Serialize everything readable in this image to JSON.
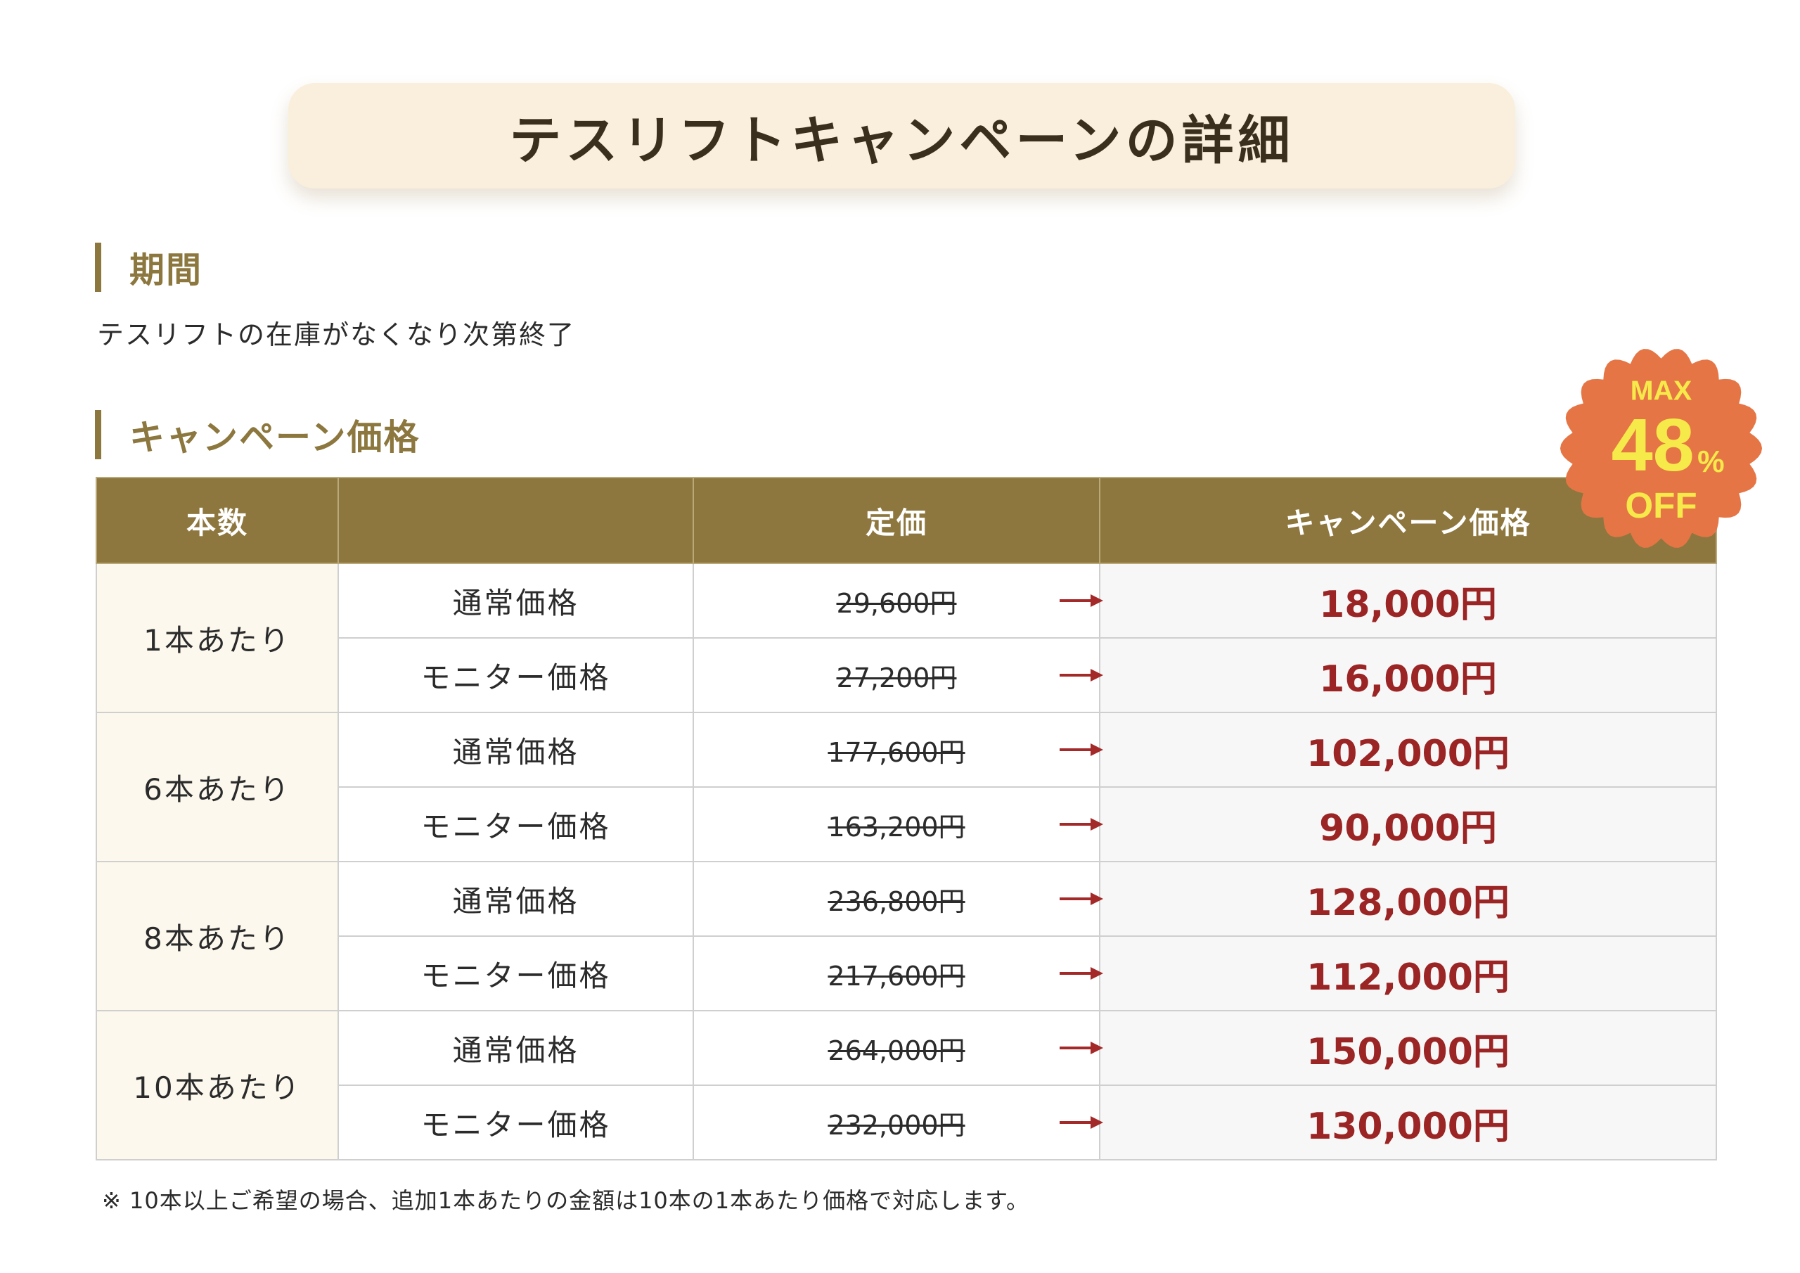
{
  "title": "テスリフトキャンペーンの詳細",
  "period": {
    "heading": "期間",
    "text": "テスリフトの在庫がなくなり次第終了"
  },
  "campaign_price": {
    "heading": "キャンペーン価格",
    "table": {
      "headers": [
        "本数",
        "",
        "定価",
        "キャンペーン価格"
      ],
      "groups": [
        {
          "quantity": "1本あたり",
          "rows": [
            {
              "type": "通常価格",
              "list_price": "29,600円",
              "campaign_price": "18,000円"
            },
            {
              "type": "モニター価格",
              "list_price": "27,200円",
              "campaign_price": "16,000円"
            }
          ]
        },
        {
          "quantity": "6本あたり",
          "rows": [
            {
              "type": "通常価格",
              "list_price": "177,600円",
              "campaign_price": "102,000円"
            },
            {
              "type": "モニター価格",
              "list_price": "163,200円",
              "campaign_price": "90,000円"
            }
          ]
        },
        {
          "quantity": "8本あたり",
          "rows": [
            {
              "type": "通常価格",
              "list_price": "236,800円",
              "campaign_price": "128,000円"
            },
            {
              "type": "モニター価格",
              "list_price": "217,600円",
              "campaign_price": "112,000円"
            }
          ]
        },
        {
          "quantity": "10本あたり",
          "rows": [
            {
              "type": "通常価格",
              "list_price": "264,000円",
              "campaign_price": "150,000円"
            },
            {
              "type": "モニター価格",
              "list_price": "232,000円",
              "campaign_price": "130,000円"
            }
          ]
        }
      ]
    },
    "note": "※ 10本以上ご希望の場合、追加1本あたりの金額は10本の1本あたり価格で対応します。"
  },
  "badge": {
    "top": "MAX",
    "number": "48",
    "unit": "%",
    "bottom": "OFF"
  },
  "colors": {
    "accent": "#8e773e",
    "title_bg": "#faefdc",
    "campaign_price": "#9b2424",
    "arrow": "#a42a2a",
    "badge": "#e67545",
    "badge_text": "#f6ea4a"
  },
  "icons": {
    "arrow": "arrow-right-icon",
    "badge": "scalloped-badge-icon"
  }
}
